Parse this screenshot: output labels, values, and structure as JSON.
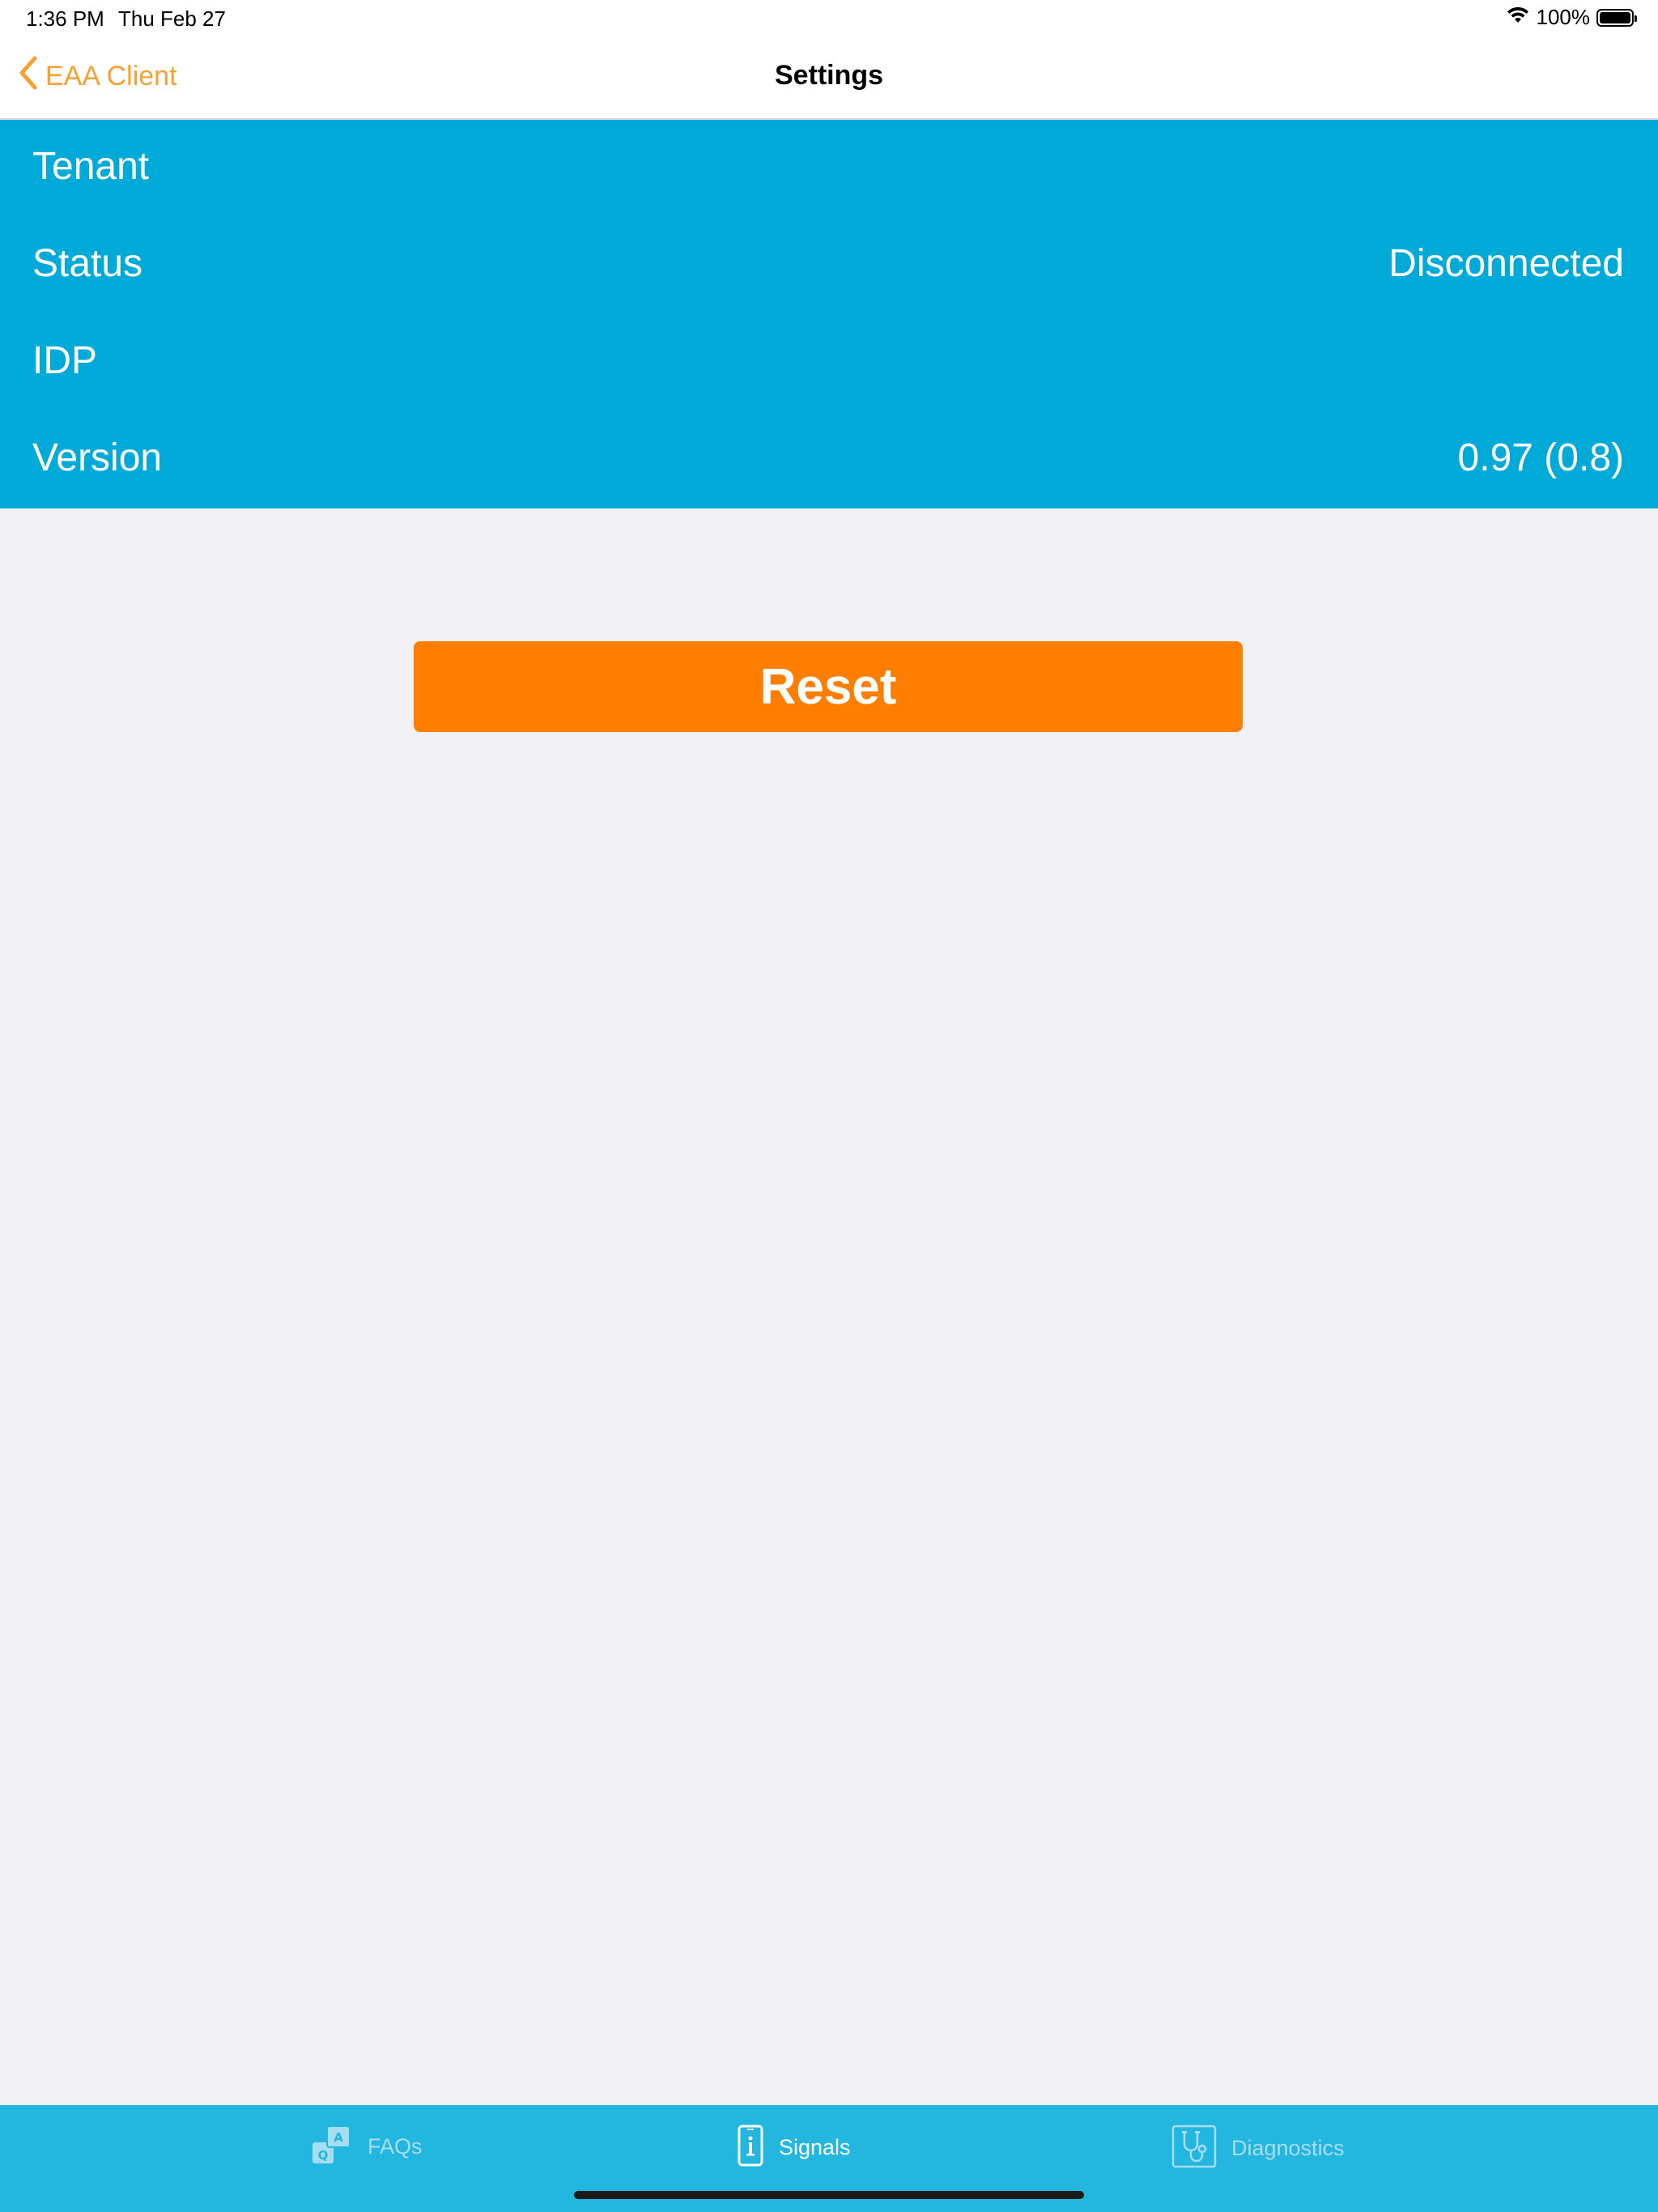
{
  "status_bar": {
    "time": "1:36 PM",
    "date": "Thu Feb 27",
    "battery_percent": "100%",
    "battery_level": 1.0,
    "icons": [
      "wifi-icon",
      "battery-icon"
    ]
  },
  "nav": {
    "back_label": "EAA Client",
    "title": "Settings",
    "accent_color": "#f6a132"
  },
  "info_panel": {
    "background_color": "#00aad8",
    "rows": [
      {
        "label": "Tenant",
        "value": ""
      },
      {
        "label": "Status",
        "value": "Disconnected"
      },
      {
        "label": "IDP",
        "value": ""
      },
      {
        "label": "Version",
        "value": "0.97 (0.8)"
      }
    ]
  },
  "reset_button": {
    "label": "Reset",
    "color": "#ff7e00"
  },
  "tab_bar": {
    "background_color": "#23b6de",
    "tabs": [
      {
        "label": "FAQs",
        "icon": "faq-icon",
        "active": false
      },
      {
        "label": "Signals",
        "icon": "device-info-icon",
        "active": true
      },
      {
        "label": "Diagnostics",
        "icon": "stethoscope-icon",
        "active": false
      }
    ]
  }
}
